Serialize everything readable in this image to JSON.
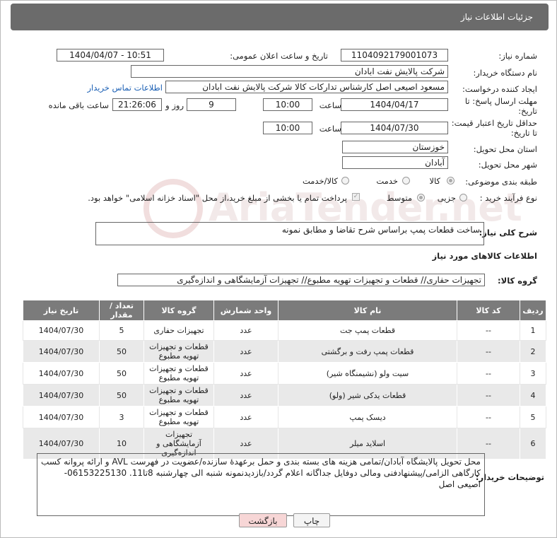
{
  "header": {
    "title": "جزئیات اطلاعات نیاز"
  },
  "form": {
    "need_number_label": "شماره نیاز:",
    "need_number": "1104092179001073",
    "announce_label": "تاریخ و ساعت اعلان عمومی:",
    "announce_value": "1404/04/07 - 10:51",
    "buyer_org_label": "نام دستگاه خریدار:",
    "buyer_org": "شرکت پالایش نفت ابادان",
    "requester_label": "ایجاد کننده درخواست:",
    "requester": "مسعود اصیعی اصل کارشناس تدارکات کالا  شرکت پالایش نفت ابادان",
    "contact_link": "اطلاعات تماس خریدار",
    "deadline_label_1": "مهلت ارسال پاسخ: تا",
    "deadline_label_2": "تاریخ:",
    "deadline_date": "1404/04/17",
    "time_word": "ساعت",
    "deadline_time": "10:00",
    "days_value": "9",
    "days_word": "روز و",
    "remaining_time": "21:26:06",
    "remaining_word": "ساعت باقی مانده",
    "validity_label_1": "حداقل تاریخ اعتبار قیمت:",
    "validity_label_2": "تا تاریخ:",
    "validity_date": "1404/07/30",
    "validity_time": "10:00",
    "province_label": "استان محل تحویل:",
    "province": "خوزستان",
    "city_label": "شهر محل تحویل:",
    "city": "آبادان",
    "category_label": "طبقه بندی موضوعی:",
    "category_options": [
      "کالا",
      "خدمت",
      "کالا/خدمت"
    ],
    "process_label": "نوع فرآیند خرید :",
    "process_options": [
      "جزیی",
      "متوسط"
    ],
    "payment_note": "پرداخت تمام یا بخشی از مبلغ خرید،از محل \"اسناد خزانه اسلامی\" خواهد بود.",
    "description_label": "شرح کلی نیاز:",
    "description": "ساخت قطعات پمپ براساس شرح تقاضا و مطابق نمونه",
    "goods_info_title": "اطلاعات کالاهای مورد نیاز",
    "goods_group_label": "گروه کالا:",
    "goods_group": "تجهیزات حفاری//  قطعات و تجهیزات تهویه مطبوع// تجهیزات آزمایشگاهی و اندازه‌گیری",
    "buyer_notes_label": "توضیحات خریدار:",
    "buyer_notes": "محل تحویل پالایشگاه آبادان/تمامی هزینه های بسته بندی و حمل برعهدۀ سازنده/عضویت در فهرست AVL و ارائه پروانه کسب کارگاهی الزامی/پیشنهادفنی ومالی دوفایل جداگانه اعلام گردد/بازدیدنمونه شنبه الی چهارشنبه 8تا11. 06153225130- اصیعی اصل"
  },
  "table": {
    "headers": [
      "ردیف",
      "کد کالا",
      "نام کالا",
      "واحد شمارش",
      "گروه کالا",
      "تعداد / مقدار",
      "تاریخ نیاز"
    ],
    "rows": [
      [
        "1",
        "--",
        "قطعات پمپ جت",
        "عدد",
        "تجهیزات حفاری",
        "5",
        "1404/07/30"
      ],
      [
        "2",
        "--",
        "قطعات پمپ رفت و برگشتی",
        "عدد",
        "قطعات و تجهیزات تهویه مطبوع",
        "50",
        "1404/07/30"
      ],
      [
        "3",
        "--",
        "سیت ولو (نشیمنگاه شیر)",
        "عدد",
        "قطعات و تجهیزات تهویه مطبوع",
        "50",
        "1404/07/30"
      ],
      [
        "4",
        "--",
        "قطعات یدکی شیر (ولو)",
        "عدد",
        "قطعات و تجهیزات تهویه مطبوع",
        "50",
        "1404/07/30"
      ],
      [
        "5",
        "--",
        "دیسک پمپ",
        "عدد",
        "قطعات و تجهیزات تهویه مطبوع",
        "3",
        "1404/07/30"
      ],
      [
        "6",
        "--",
        "اسلاید میلر",
        "عدد",
        "تجهیزات آزمایشگاهی و اندازه‌گیری",
        "10",
        "1404/07/30"
      ]
    ]
  },
  "buttons": {
    "print": "چاپ",
    "back": "بازگشت"
  },
  "watermark": "AriaTender.net",
  "colors": {
    "header_bg": "#6b6b6b",
    "table_header_bg": "#7b7b7b",
    "link": "#1a5fb4",
    "back_button_bg": "#f7d6d6"
  }
}
